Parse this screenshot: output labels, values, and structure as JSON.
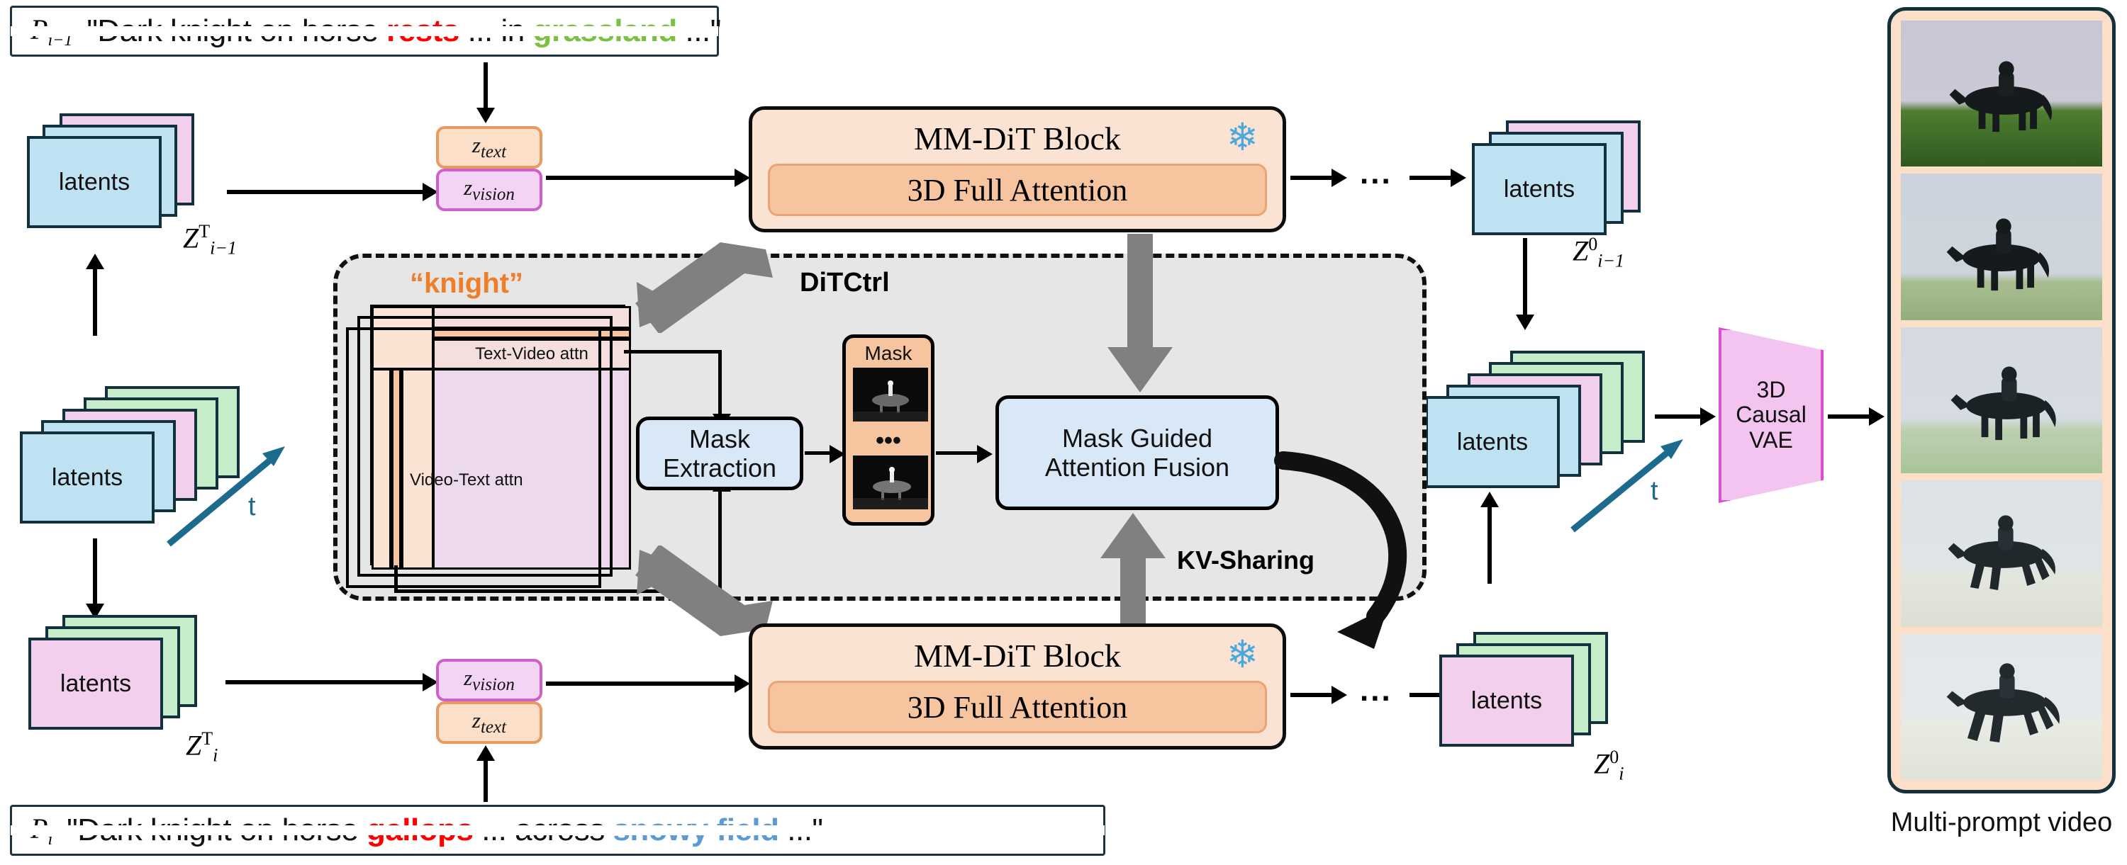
{
  "prompts": {
    "top": {
      "var": "P",
      "var_sub": "i−1",
      "open_quote": "\"Dark knight on horse ",
      "kw1": "rests",
      "mid": " ... in ",
      "kw2": "grassland",
      "tail": " ...\""
    },
    "bottom": {
      "var": "P",
      "var_sub": "i",
      "open_quote": "\"Dark knight on horse ",
      "kw1": "gallops",
      "mid": " ... across ",
      "kw2": "snowy field",
      "tail": " ...\""
    }
  },
  "labels": {
    "latents": "latents",
    "z_text": "z",
    "z_text_sub": "text",
    "z_vision": "z",
    "z_vision_sub": "vision",
    "t_axis": "t",
    "dots": "...",
    "mask_dots": "•••"
  },
  "z_labels": {
    "top_left": {
      "base": "Z",
      "sup": "T",
      "sub": "i−1"
    },
    "bottom_left": {
      "base": "Z",
      "sup": "T",
      "sub": "i"
    },
    "top_right": {
      "base": "Z",
      "sup": "0",
      "sub": "i−1"
    },
    "bottom_right": {
      "base": "Z",
      "sup": "0",
      "sub": "i"
    }
  },
  "mmdit": {
    "title": "MM-DiT Block",
    "inner": "3D Full Attention",
    "frozen_icon": "snowflake-icon",
    "frozen_glyph": "❄"
  },
  "ditctrl": {
    "title": "DiTCtrl",
    "knight_token": "“knight”",
    "attn_text_video": "Text-Video attn",
    "attn_video_text": "Video-Text attn",
    "mask_extraction": "Mask\nExtraction",
    "mask_extraction_line1": "Mask",
    "mask_extraction_line2": "Extraction",
    "mask_panel_title": "Mask",
    "fusion_line1": "Mask Guided",
    "fusion_line2": "Attention Fusion",
    "kv_sharing": "KV-Sharing"
  },
  "vae": {
    "line1": "3D",
    "line2": "Causal",
    "line3": "VAE"
  },
  "video": {
    "caption": "Multi-prompt video",
    "frames": [
      {
        "id": "frame-1",
        "scene": "grassland",
        "sky": "#c9c6d6",
        "ground": "#5d8a3a"
      },
      {
        "id": "frame-2",
        "scene": "grassland-pale",
        "sky": "#cdd3dc",
        "ground": "#a8be92"
      },
      {
        "id": "frame-3",
        "scene": "transition",
        "sky": "#d4dae0",
        "ground": "#b9cdae"
      },
      {
        "id": "frame-4",
        "scene": "snowy",
        "sky": "#dde2e6",
        "ground": "#e2e6dd"
      },
      {
        "id": "frame-5",
        "scene": "snowy-field",
        "sky": "#e3e7ea",
        "ground": "#e8ebe3"
      }
    ]
  },
  "colors": {
    "latent_blue": "#bfe2f2",
    "latent_pink": "#f2cfec",
    "latent_green": "#c6ecc9",
    "border_dark": "#13303d",
    "peach": "#fbdfc8",
    "peach_deep": "#f7c4a0",
    "process_blue": "#d9e8f6",
    "vae_pink": "#f4c4f0",
    "accent_orange": "#f07d28",
    "kw_red": "#ff0000",
    "kw_green": "#7ac143",
    "kw_blue": "#5b9bd5",
    "snowflake_blue": "#4aa8dd",
    "gray_panel": "#e6e6e6",
    "teal": "#1c6a8e"
  }
}
